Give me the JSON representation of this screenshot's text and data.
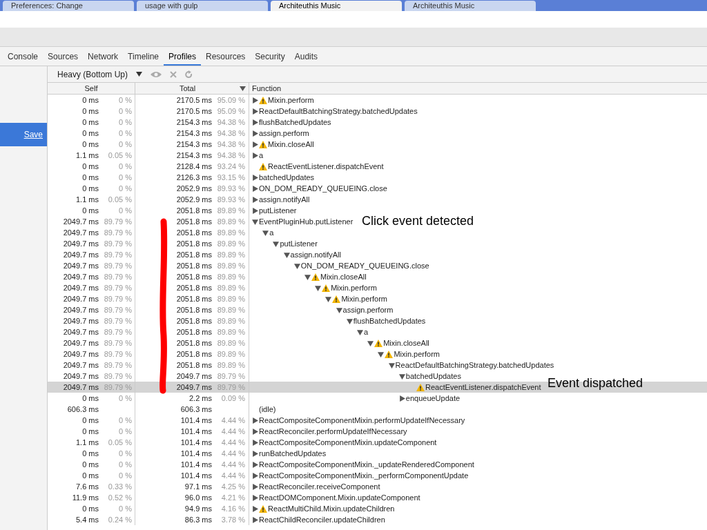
{
  "browser_tabs": [
    {
      "title": "Preferences: Change",
      "selected": false
    },
    {
      "title": "usage with gulp",
      "selected": false
    },
    {
      "title": "Architeuthis Music",
      "selected": true
    },
    {
      "title": "Architeuthis Music",
      "selected": false
    }
  ],
  "devtools_tabs": [
    {
      "label": "Console",
      "selected": false
    },
    {
      "label": "Sources",
      "selected": false
    },
    {
      "label": "Network",
      "selected": false
    },
    {
      "label": "Timeline",
      "selected": false
    },
    {
      "label": "Profiles",
      "selected": true
    },
    {
      "label": "Resources",
      "selected": false
    },
    {
      "label": "Security",
      "selected": false
    },
    {
      "label": "Audits",
      "selected": false
    }
  ],
  "sidebar": {
    "save_link": "Save"
  },
  "toolbar": {
    "view_mode": "Heavy (Bottom Up)"
  },
  "table": {
    "columns": [
      "Self",
      "Total",
      "Function"
    ],
    "rows": [
      {
        "self": "0 ms",
        "self_pct": "0 %",
        "total": "2170.5 ms",
        "total_pct": "95.09 %",
        "function": "Mixin.perform",
        "warning": true,
        "kind": "node",
        "expanded": false,
        "selected": false
      },
      {
        "self": "0 ms",
        "self_pct": "0 %",
        "total": "2170.5 ms",
        "total_pct": "95.09 %",
        "function": "ReactDefaultBatchingStrategy.batchedUpdates",
        "warning": false,
        "kind": "node",
        "expanded": false,
        "selected": false
      },
      {
        "self": "0 ms",
        "self_pct": "0 %",
        "total": "2154.3 ms",
        "total_pct": "94.38 %",
        "function": "flushBatchedUpdates",
        "warning": false,
        "kind": "node",
        "expanded": false,
        "selected": false
      },
      {
        "self": "0 ms",
        "self_pct": "0 %",
        "total": "2154.3 ms",
        "total_pct": "94.38 %",
        "function": "assign.perform",
        "warning": false,
        "kind": "node",
        "expanded": false,
        "selected": false
      },
      {
        "self": "0 ms",
        "self_pct": "0 %",
        "total": "2154.3 ms",
        "total_pct": "94.38 %",
        "function": "Mixin.closeAll",
        "warning": true,
        "kind": "node",
        "expanded": false,
        "selected": false
      },
      {
        "self": "1.1 ms",
        "self_pct": "0.05 %",
        "total": "2154.3 ms",
        "total_pct": "94.38 %",
        "function": "a",
        "warning": false,
        "kind": "node",
        "expanded": false,
        "selected": false
      },
      {
        "self": "0 ms",
        "self_pct": "0 %",
        "total": "2128.4 ms",
        "total_pct": "93.24 %",
        "function": "ReactEventListener.dispatchEvent",
        "warning": true,
        "kind": "leaf",
        "selected": false
      },
      {
        "self": "0 ms",
        "self_pct": "0 %",
        "total": "2126.3 ms",
        "total_pct": "93.15 %",
        "function": "batchedUpdates",
        "warning": false,
        "kind": "node",
        "expanded": false,
        "selected": false
      },
      {
        "self": "0 ms",
        "self_pct": "0 %",
        "total": "2052.9 ms",
        "total_pct": "89.93 %",
        "function": "ON_DOM_READY_QUEUEING.close",
        "warning": false,
        "kind": "node",
        "expanded": false,
        "selected": false
      },
      {
        "self": "1.1 ms",
        "self_pct": "0.05 %",
        "total": "2052.9 ms",
        "total_pct": "89.93 %",
        "function": "assign.notifyAll",
        "warning": false,
        "kind": "node",
        "expanded": false,
        "selected": false
      },
      {
        "self": "0 ms",
        "self_pct": "0 %",
        "total": "2051.8 ms",
        "total_pct": "89.89 %",
        "function": "putListener",
        "warning": false,
        "kind": "node",
        "expanded": false,
        "selected": false
      },
      {
        "self": "2049.7 ms",
        "self_pct": "89.79 %",
        "total": "2051.8 ms",
        "total_pct": "89.89 %",
        "function": "EventPluginHub.putListener",
        "warning": false,
        "kind": "node",
        "expanded": true,
        "selected": false,
        "children": [
          {
            "self": "2049.7 ms",
            "self_pct": "89.79 %",
            "total": "2051.8 ms",
            "total_pct": "89.89 %",
            "function": "a",
            "warning": false,
            "kind": "node",
            "expanded": true,
            "selected": false,
            "children": [
              {
                "self": "2049.7 ms",
                "self_pct": "89.79 %",
                "total": "2051.8 ms",
                "total_pct": "89.89 %",
                "function": "putListener",
                "warning": false,
                "kind": "node",
                "expanded": true,
                "selected": false,
                "children": [
                  {
                    "self": "2049.7 ms",
                    "self_pct": "89.79 %",
                    "total": "2051.8 ms",
                    "total_pct": "89.89 %",
                    "function": "assign.notifyAll",
                    "warning": false,
                    "kind": "node",
                    "expanded": true,
                    "selected": false,
                    "children": [
                      {
                        "self": "2049.7 ms",
                        "self_pct": "89.79 %",
                        "total": "2051.8 ms",
                        "total_pct": "89.89 %",
                        "function": "ON_DOM_READY_QUEUEING.close",
                        "warning": false,
                        "kind": "node",
                        "expanded": true,
                        "selected": false,
                        "children": [
                          {
                            "self": "2049.7 ms",
                            "self_pct": "89.79 %",
                            "total": "2051.8 ms",
                            "total_pct": "89.89 %",
                            "function": "Mixin.closeAll",
                            "warning": true,
                            "kind": "node",
                            "expanded": true,
                            "selected": false,
                            "children": [
                              {
                                "self": "2049.7 ms",
                                "self_pct": "89.79 %",
                                "total": "2051.8 ms",
                                "total_pct": "89.89 %",
                                "function": "Mixin.perform",
                                "warning": true,
                                "kind": "node",
                                "expanded": true,
                                "selected": false,
                                "children": [
                                  {
                                    "self": "2049.7 ms",
                                    "self_pct": "89.79 %",
                                    "total": "2051.8 ms",
                                    "total_pct": "89.89 %",
                                    "function": "Mixin.perform",
                                    "warning": true,
                                    "kind": "node",
                                    "expanded": true,
                                    "selected": false,
                                    "children": [
                                      {
                                        "self": "2049.7 ms",
                                        "self_pct": "89.79 %",
                                        "total": "2051.8 ms",
                                        "total_pct": "89.89 %",
                                        "function": "assign.perform",
                                        "warning": false,
                                        "kind": "node",
                                        "expanded": true,
                                        "selected": false,
                                        "children": [
                                          {
                                            "self": "2049.7 ms",
                                            "self_pct": "89.79 %",
                                            "total": "2051.8 ms",
                                            "total_pct": "89.89 %",
                                            "function": "flushBatchedUpdates",
                                            "warning": false,
                                            "kind": "node",
                                            "expanded": true,
                                            "selected": false,
                                            "children": [
                                              {
                                                "self": "2049.7 ms",
                                                "self_pct": "89.79 %",
                                                "total": "2051.8 ms",
                                                "total_pct": "89.89 %",
                                                "function": "a",
                                                "warning": false,
                                                "kind": "node",
                                                "expanded": true,
                                                "selected": false,
                                                "children": [
                                                  {
                                                    "self": "2049.7 ms",
                                                    "self_pct": "89.79 %",
                                                    "total": "2051.8 ms",
                                                    "total_pct": "89.89 %",
                                                    "function": "Mixin.closeAll",
                                                    "warning": true,
                                                    "kind": "node",
                                                    "expanded": true,
                                                    "selected": false,
                                                    "children": [
                                                      {
                                                        "self": "2049.7 ms",
                                                        "self_pct": "89.79 %",
                                                        "total": "2051.8 ms",
                                                        "total_pct": "89.89 %",
                                                        "function": "Mixin.perform",
                                                        "warning": true,
                                                        "kind": "node",
                                                        "expanded": true,
                                                        "selected": false,
                                                        "children": [
                                                          {
                                                            "self": "2049.7 ms",
                                                            "self_pct": "89.79 %",
                                                            "total": "2051.8 ms",
                                                            "total_pct": "89.89 %",
                                                            "function": "ReactDefaultBatchingStrategy.batchedUpdates",
                                                            "warning": false,
                                                            "kind": "node",
                                                            "expanded": true,
                                                            "selected": false,
                                                            "children": [
                                                              {
                                                                "self": "2049.7 ms",
                                                                "self_pct": "89.79 %",
                                                                "total": "2049.7 ms",
                                                                "total_pct": "89.79 %",
                                                                "function": "batchedUpdates",
                                                                "warning": false,
                                                                "kind": "node",
                                                                "expanded": true,
                                                                "selected": false,
                                                                "children": [
                                                                  {
                                                                    "self": "2049.7 ms",
                                                                    "self_pct": "89.79 %",
                                                                    "total": "2049.7 ms",
                                                                    "total_pct": "89.79 %",
                                                                    "function": "ReactEventListener.dispatchEvent",
                                                                    "warning": true,
                                                                    "kind": "leaf",
                                                                    "selected": true
                                                                  }
                                                                ]
                                                              },
                                                              {
                                                                "self": "0 ms",
                                                                "self_pct": "0 %",
                                                                "total": "2.2 ms",
                                                                "total_pct": "0.09 %",
                                                                "function": "enqueueUpdate",
                                                                "warning": false,
                                                                "kind": "node",
                                                                "expanded": false,
                                                                "selected": false
                                                              }
                                                            ]
                                                          }
                                                        ]
                                                      }
                                                    ]
                                                  }
                                                ]
                                              }
                                            ]
                                          }
                                        ]
                                      }
                                    ]
                                  }
                                ]
                              }
                            ]
                          }
                        ]
                      }
                    ]
                  }
                ]
              }
            ]
          }
        ]
      },
      {
        "self": "606.3 ms",
        "total": "606.3 ms",
        "function": "(idle)",
        "warning": false,
        "kind": "leaf",
        "selected": false
      },
      {
        "self": "0 ms",
        "self_pct": "0 %",
        "total": "101.4 ms",
        "total_pct": "4.44 %",
        "function": "ReactCompositeComponentMixin.performUpdateIfNecessary",
        "warning": false,
        "kind": "node",
        "expanded": false,
        "selected": false
      },
      {
        "self": "0 ms",
        "self_pct": "0 %",
        "total": "101.4 ms",
        "total_pct": "4.44 %",
        "function": "ReactReconciler.performUpdateIfNecessary",
        "warning": false,
        "kind": "node",
        "expanded": false,
        "selected": false
      },
      {
        "self": "1.1 ms",
        "self_pct": "0.05 %",
        "total": "101.4 ms",
        "total_pct": "4.44 %",
        "function": "ReactCompositeComponentMixin.updateComponent",
        "warning": false,
        "kind": "node",
        "expanded": false,
        "selected": false
      },
      {
        "self": "0 ms",
        "self_pct": "0 %",
        "total": "101.4 ms",
        "total_pct": "4.44 %",
        "function": "runBatchedUpdates",
        "warning": false,
        "kind": "node",
        "expanded": false,
        "selected": false
      },
      {
        "self": "0 ms",
        "self_pct": "0 %",
        "total": "101.4 ms",
        "total_pct": "4.44 %",
        "function": "ReactCompositeComponentMixin._updateRenderedComponent",
        "warning": false,
        "kind": "node",
        "expanded": false,
        "selected": false
      },
      {
        "self": "0 ms",
        "self_pct": "0 %",
        "total": "101.4 ms",
        "total_pct": "4.44 %",
        "function": "ReactCompositeComponentMixin._performComponentUpdate",
        "warning": false,
        "kind": "node",
        "expanded": false,
        "selected": false
      },
      {
        "self": "7.6 ms",
        "self_pct": "0.33 %",
        "total": "97.1 ms",
        "total_pct": "4.25 %",
        "function": "ReactReconciler.receiveComponent",
        "warning": false,
        "kind": "node",
        "expanded": false,
        "selected": false
      },
      {
        "self": "11.9 ms",
        "self_pct": "0.52 %",
        "total": "96.0 ms",
        "total_pct": "4.21 %",
        "function": "ReactDOMComponent.Mixin.updateComponent",
        "warning": false,
        "kind": "node",
        "expanded": false,
        "selected": false
      },
      {
        "self": "0 ms",
        "self_pct": "0 %",
        "total": "94.9 ms",
        "total_pct": "4.16 %",
        "function": "ReactMultiChild.Mixin.updateChildren",
        "warning": true,
        "kind": "node",
        "expanded": false,
        "selected": false
      },
      {
        "self": "5.4 ms",
        "self_pct": "0.24 %",
        "total": "86.3 ms",
        "total_pct": "3.78 %",
        "function": "ReactChildReconciler.updateChildren",
        "warning": false,
        "kind": "node",
        "expanded": false,
        "selected": false
      }
    ]
  },
  "annotations": [
    "Click event detected",
    "Event dispatched"
  ]
}
